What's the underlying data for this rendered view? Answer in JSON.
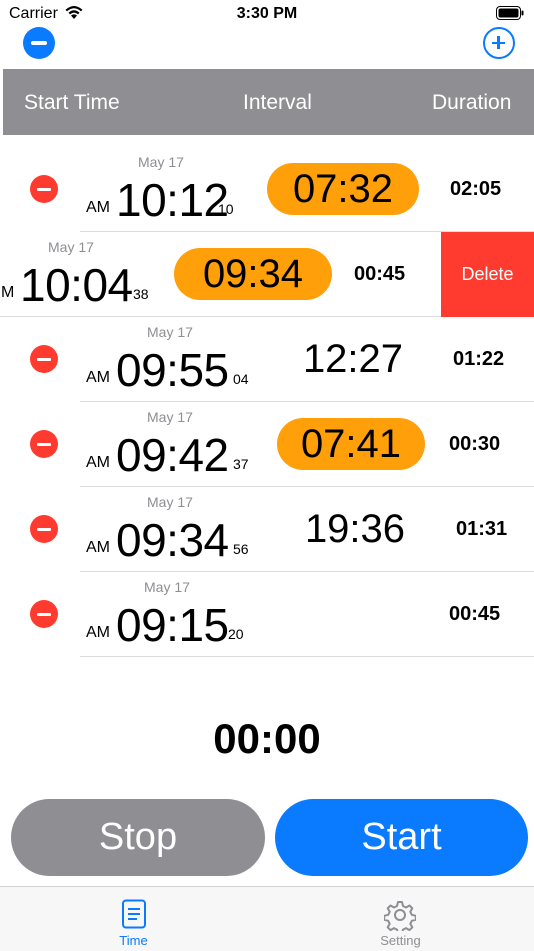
{
  "status": {
    "carrier": "Carrier",
    "time": "3:30 PM"
  },
  "colors": {
    "accent": "#0a7aff",
    "highlight": "#ff9f0a",
    "destructive": "#ff3b30",
    "header": "#8e8e93"
  },
  "header": {
    "start_time": "Start Time",
    "interval": "Interval",
    "duration": "Duration"
  },
  "rows": [
    {
      "date": "May 17",
      "ampm": "AM",
      "time": "10:12",
      "seconds": "10",
      "interval": "07:32",
      "highlighted": true,
      "duration": "02:05"
    },
    {
      "date": "May 17",
      "ampm": "M",
      "time": "10:04",
      "seconds": "38",
      "interval": "09:34",
      "highlighted": true,
      "duration": "00:45",
      "action": "Delete"
    },
    {
      "date": "May 17",
      "ampm": "AM",
      "time": "09:55",
      "seconds": "04",
      "interval": "12:27",
      "highlighted": false,
      "duration": "01:22"
    },
    {
      "date": "May 17",
      "ampm": "AM",
      "time": "09:42",
      "seconds": "37",
      "interval": "07:41",
      "highlighted": true,
      "duration": "00:30"
    },
    {
      "date": "May 17",
      "ampm": "AM",
      "time": "09:34",
      "seconds": "56",
      "interval": "19:36",
      "highlighted": false,
      "duration": "01:31"
    },
    {
      "date": "May 17",
      "ampm": "AM",
      "time": "09:15",
      "seconds": "20",
      "interval": "",
      "highlighted": false,
      "duration": "00:45"
    }
  ],
  "timer": "00:00",
  "buttons": {
    "stop": "Stop",
    "start": "Start"
  },
  "tabs": [
    {
      "label": "Time",
      "icon": "document-icon",
      "active": true
    },
    {
      "label": "Setting",
      "icon": "gear-icon",
      "active": false
    }
  ]
}
